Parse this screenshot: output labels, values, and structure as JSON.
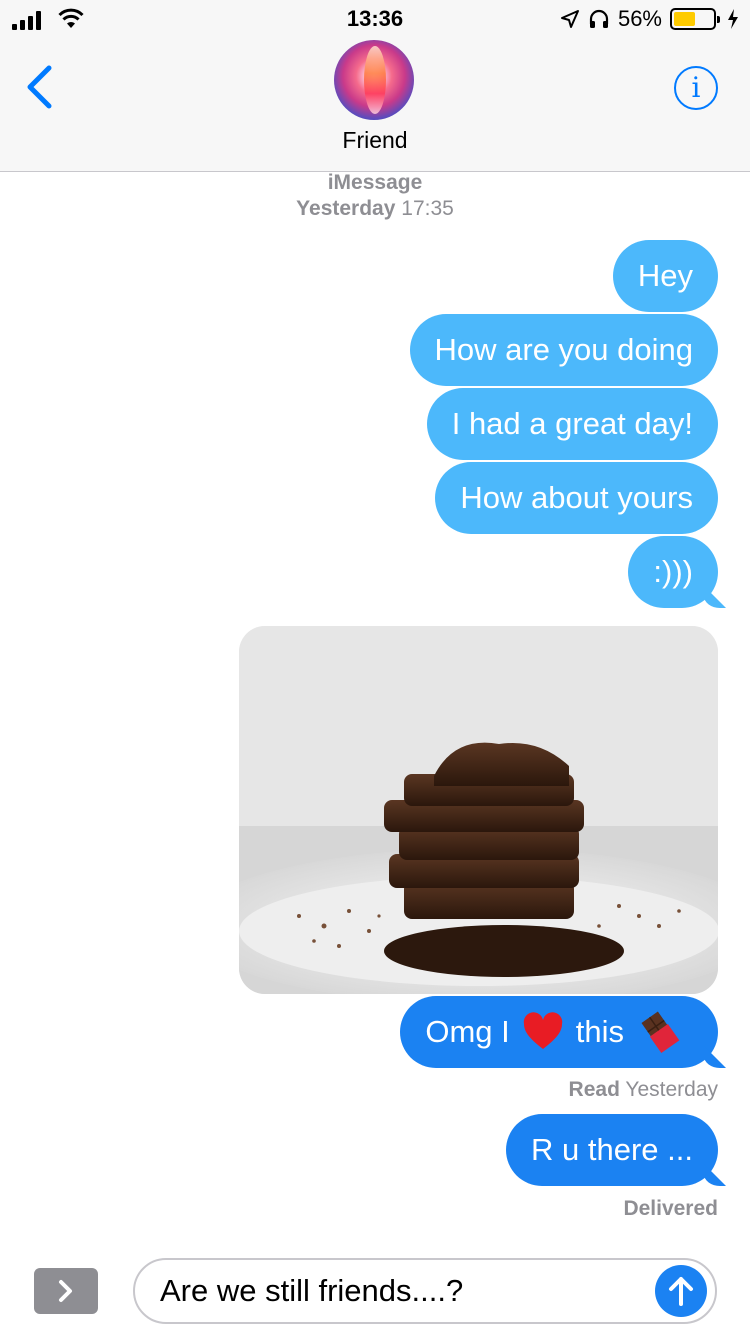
{
  "status_bar": {
    "time": "13:36",
    "battery_percent": "56%",
    "battery_level": 0.56,
    "battery_color": "#fecb00"
  },
  "header": {
    "contact_name": "Friend",
    "back_icon": "chevron-left-icon",
    "info_icon": "info-circle-icon",
    "accent_color": "#007aff"
  },
  "conversation": {
    "service": "iMessage",
    "day": "Yesterday",
    "time": "17:35",
    "messages": [
      {
        "text": "Hey"
      },
      {
        "text": "How are you doing"
      },
      {
        "text": "I had a great day!"
      },
      {
        "text": "How about yours"
      },
      {
        "text": ":)))"
      }
    ],
    "photo_icon": "chocolate-photo",
    "image_reply": {
      "text_before": "Omg I",
      "text_after": "this",
      "emoji_heart": "red-heart-emoji",
      "emoji_chocolate": "chocolate-bar-emoji"
    },
    "read_receipt": {
      "label": "Read",
      "when": "Yesterday"
    },
    "last_message": "R u there ...",
    "delivered_label": "Delivered"
  },
  "input_bar": {
    "apps_icon": "chevron-right-icon",
    "text": "Are we still friends....?",
    "send_icon": "arrow-up-icon"
  },
  "colors": {
    "bubble_light": "#4cb8fb",
    "bubble_dark": "#1b82f2",
    "meta_gray": "#8e8e93"
  }
}
